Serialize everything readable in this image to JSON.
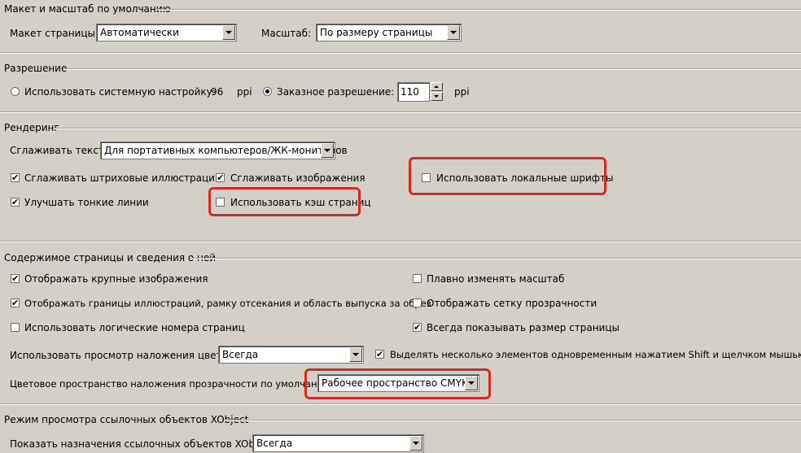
{
  "sections": {
    "layout": {
      "title": "Макет и масштаб по умолчанию",
      "page_layout_label": "Макет страницы:",
      "page_layout_value": "Автоматически",
      "zoom_label": "Масштаб:",
      "zoom_value": "По размеру страницы"
    },
    "resolution": {
      "title": "Разрешение",
      "system_label": "Использовать системную настройку:",
      "system_value": "96",
      "unit": "ppi",
      "custom_label": "Заказное разрешение:",
      "custom_value": "110",
      "custom_unit": "ppi",
      "selected": "custom"
    },
    "rendering": {
      "title": "Рендеринг",
      "smooth_text_label": "Сглаживать текст:",
      "smooth_text_value": "Для портативных компьютеров/ЖК-мониторов",
      "smooth_line_art": {
        "label": "Сглаживать штриховые иллюстрации",
        "checked": true
      },
      "smooth_images": {
        "label": "Сглаживать изображения",
        "checked": true
      },
      "local_fonts": {
        "label": "Использовать локальные шрифты",
        "checked": false
      },
      "enhance_thin_lines": {
        "label": "Улучшать тонкие линии",
        "checked": true
      },
      "page_cache": {
        "label": "Использовать кэш страниц",
        "checked": false
      }
    },
    "page_content": {
      "title": "Содержимое страницы и сведения о ней",
      "large_images": {
        "label": "Отображать крупные изображения",
        "checked": true
      },
      "smooth_zoom": {
        "label": "Плавно изменять масштаб",
        "checked": false
      },
      "art_trim_bleed": {
        "label": "Отображать границы иллюстраций, рамку отсекания и область выпуска за обрез",
        "checked": true
      },
      "transparency_grid": {
        "label": "Отображать сетку прозрачности",
        "checked": false
      },
      "logical_page_numbers": {
        "label": "Использовать логические номера страниц",
        "checked": false
      },
      "always_page_size": {
        "label": "Всегда показывать размер страницы",
        "checked": true
      },
      "overprint_label": "Использовать просмотр наложения цветов:",
      "overprint_value": "Всегда",
      "shift_click": {
        "label": "Выделять несколько элементов одновременным нажатием Shift и щелчком мышью",
        "checked": true
      },
      "blend_space_label": "Цветовое пространство наложения прозрачности по умолчанию:",
      "blend_space_value": "Рабочее пространство CMYK"
    },
    "xobject": {
      "title": "Режим просмотра ссылочных объектов XObject",
      "show_targets_label": "Показать назначения ссылочных объектов XObject:",
      "show_targets_value": "Всегда"
    }
  },
  "colors": {
    "background": "#d4d0c8",
    "highlight": "#d42a2a"
  },
  "check_glyph": "✔"
}
